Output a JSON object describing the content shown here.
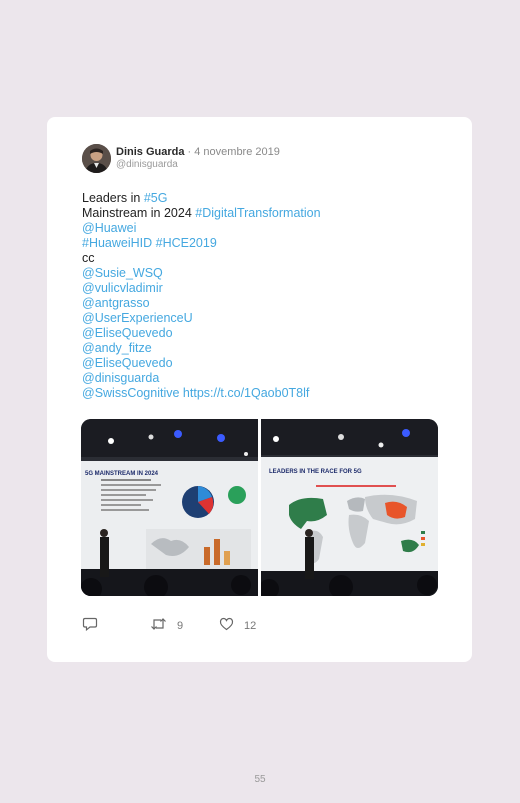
{
  "tweet": {
    "author_name": "Dinis Guarda",
    "separator": " · ",
    "date": "4 novembre 2019",
    "handle": "@dinisguarda",
    "lines": [
      [
        {
          "t": "Leaders in ",
          "link": false
        },
        {
          "t": "#5G",
          "link": true
        }
      ],
      [
        {
          "t": "Mainstream in 2024 ",
          "link": false
        },
        {
          "t": "#DigitalTransformation",
          "link": true
        }
      ],
      [
        {
          "t": "@Huawei",
          "link": true
        }
      ],
      [
        {
          "t": "#HuaweiHID #HCE2019",
          "link": true
        }
      ],
      [
        {
          "t": "cc",
          "link": false
        }
      ],
      [
        {
          "t": "@Susie_WSQ",
          "link": true
        }
      ],
      [
        {
          "t": "@vulicvladimir",
          "link": true
        }
      ],
      [
        {
          "t": "@antgrasso",
          "link": true
        }
      ],
      [
        {
          "t": "@UserExperienceU",
          "link": true
        }
      ],
      [
        {
          "t": "@EliseQuevedo",
          "link": true
        }
      ],
      [
        {
          "t": "@andy_fitze",
          "link": true
        }
      ],
      [
        {
          "t": "@EliseQuevedo",
          "link": true
        }
      ],
      [
        {
          "t": "@dinisguarda",
          "link": true
        }
      ],
      [
        {
          "t": "@SwissCognitive https://t.co/1Qaob0T8lf",
          "link": true
        }
      ]
    ],
    "photos": {
      "left_slide_title": "5G MAINSTREAM IN 2024",
      "right_slide_title": "LEADERS IN THE RACE FOR 5G"
    },
    "actions": {
      "retweets": "9",
      "likes": "12"
    }
  },
  "colors": {
    "link": "#45a8e0",
    "card": "#ffffff",
    "page_background": "#ece6ec"
  },
  "page_number": "55"
}
